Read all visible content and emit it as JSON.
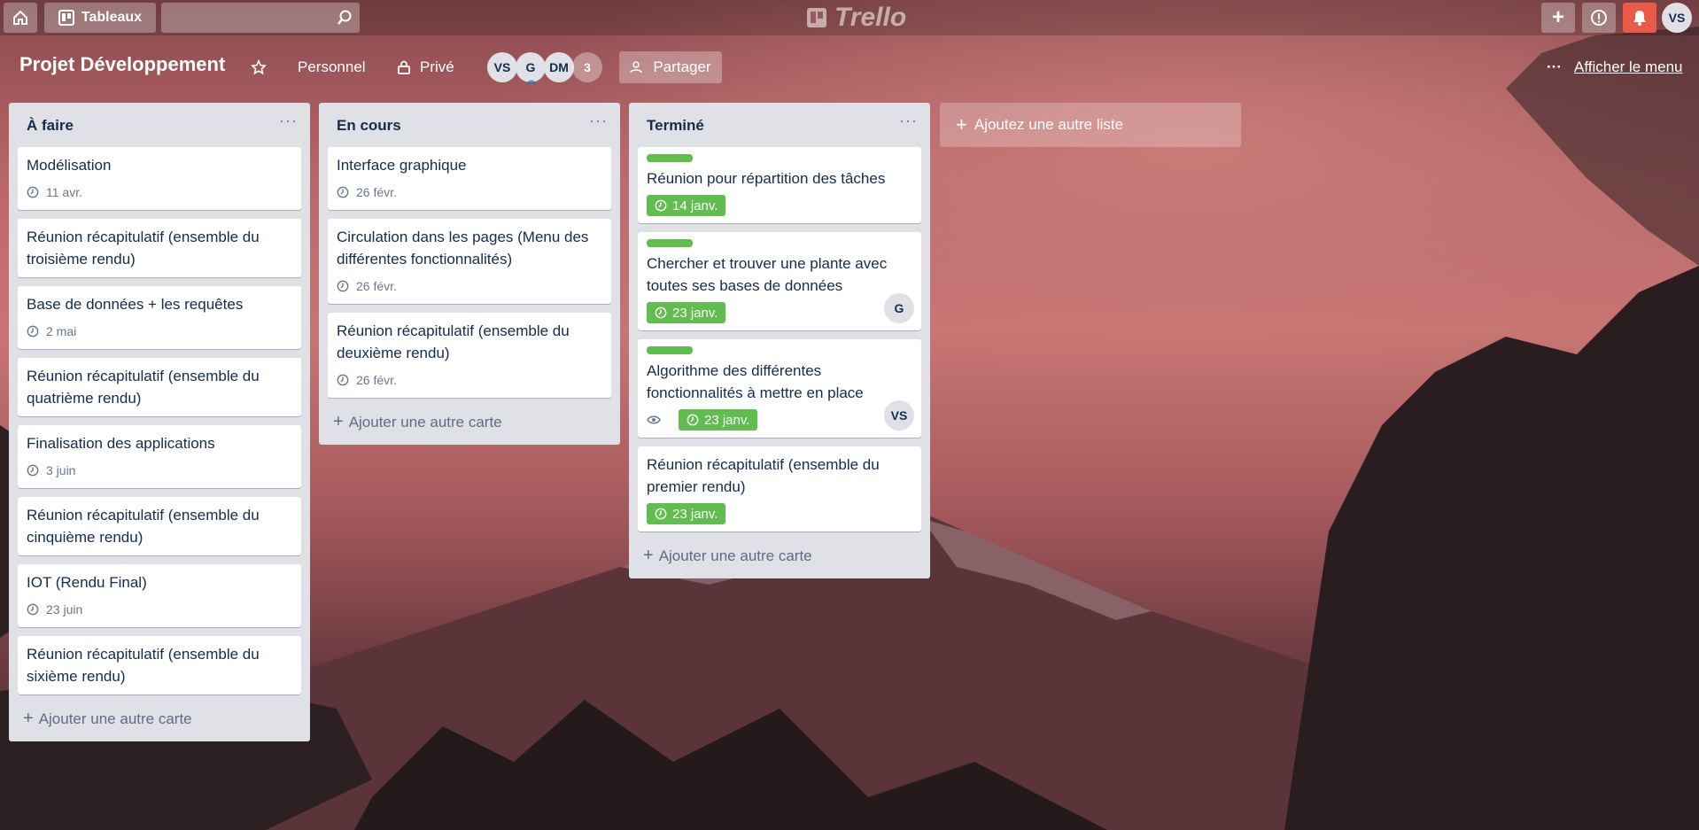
{
  "topbar": {
    "boards_label": "Tableaux",
    "search_placeholder": "",
    "logo_text": "Trello",
    "user_initials": "VS"
  },
  "board": {
    "title": "Projet Développement",
    "visibility_team": "Personnel",
    "visibility": "Privé",
    "members": [
      "VS",
      "G",
      "DM"
    ],
    "member_count": "3",
    "share_label": "Partager",
    "menu_label": "Afficher le menu"
  },
  "lists": [
    {
      "title": "À faire",
      "menu": "···",
      "cards": [
        {
          "title": "Modélisation",
          "due": "11 avr."
        },
        {
          "title": "Réunion récapitulatif (ensemble du troisième rendu)"
        },
        {
          "title": "Base de données + les requêtes",
          "due": "2 mai"
        },
        {
          "title": "Réunion récapitulatif (ensemble du quatrième rendu)"
        },
        {
          "title": "Finalisation des applications",
          "due": "3 juin"
        },
        {
          "title": "Réunion récapitulatif (ensemble du cinquième rendu)"
        },
        {
          "title": "IOT (Rendu Final)",
          "due": "23 juin"
        },
        {
          "title": "Réunion récapitulatif (ensemble du sixième rendu)"
        }
      ],
      "add_card": "Ajouter une autre carte"
    },
    {
      "title": "En cours",
      "menu": "···",
      "cards": [
        {
          "title": "Interface graphique",
          "due": "26 févr."
        },
        {
          "title": "Circulation dans les pages (Menu des différentes fonctionnalités)",
          "due": "26 févr."
        },
        {
          "title": "Réunion récapitulatif (ensemble du deuxième rendu)",
          "due": "26 févr."
        }
      ],
      "add_card": "Ajouter une autre carte"
    },
    {
      "title": "Terminé",
      "menu": "···",
      "cards": [
        {
          "title": "Réunion pour répartition des tâches",
          "due": "14 janv.",
          "label_color": "#61bd4f"
        },
        {
          "title": "Chercher et trouver une plante avec toutes ses bases de données",
          "due": "23 janv.",
          "label_color": "#61bd4f",
          "member": "G"
        },
        {
          "title": "Algorithme des différentes fonctionnalités à mettre en place",
          "due": "23 janv.",
          "label_color": "#61bd4f",
          "member": "VS",
          "watch": true
        },
        {
          "title": "Réunion récapitulatif (ensemble du premier rendu)",
          "due": "23 janv."
        }
      ],
      "add_card": "Ajouter une autre carte"
    }
  ],
  "add_list_label": "Ajoutez une autre liste",
  "colors": {
    "label_green": "#61bd4f",
    "notification_red": "#eb5a46"
  }
}
